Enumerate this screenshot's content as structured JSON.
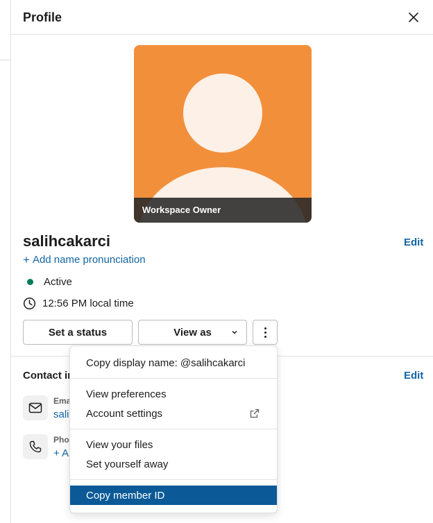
{
  "header": {
    "title": "Profile",
    "close_icon": "close-icon"
  },
  "avatar": {
    "role_badge": "Workspace Owner",
    "background_color": "#f28f3b",
    "figure_color": "#fdf0e6"
  },
  "profile": {
    "username": "salihcakarci",
    "edit_label": "Edit",
    "add_pronunciation": "Add name pronunciation",
    "presence": "Active",
    "presence_color": "#007a5a",
    "local_time": "12:56 PM local time"
  },
  "actions": {
    "set_status": "Set a status",
    "view_as": "View as"
  },
  "contact": {
    "title": "Contact in",
    "edit_label": "Edit",
    "email_label": "Ema",
    "email_value": "salih",
    "phone_label": "Pho",
    "phone_value": "+ A"
  },
  "menu": {
    "items": [
      {
        "label": "Copy display name: @salihcakarci"
      },
      {
        "label": "View preferences"
      },
      {
        "label": "Account settings",
        "icon": "external-link-icon"
      },
      {
        "label": "View your files"
      },
      {
        "label": "Set yourself away"
      },
      {
        "label": "Copy member ID",
        "selected": true
      }
    ],
    "selected_color": "#0b5a97"
  },
  "colors": {
    "link": "#1264a3"
  }
}
